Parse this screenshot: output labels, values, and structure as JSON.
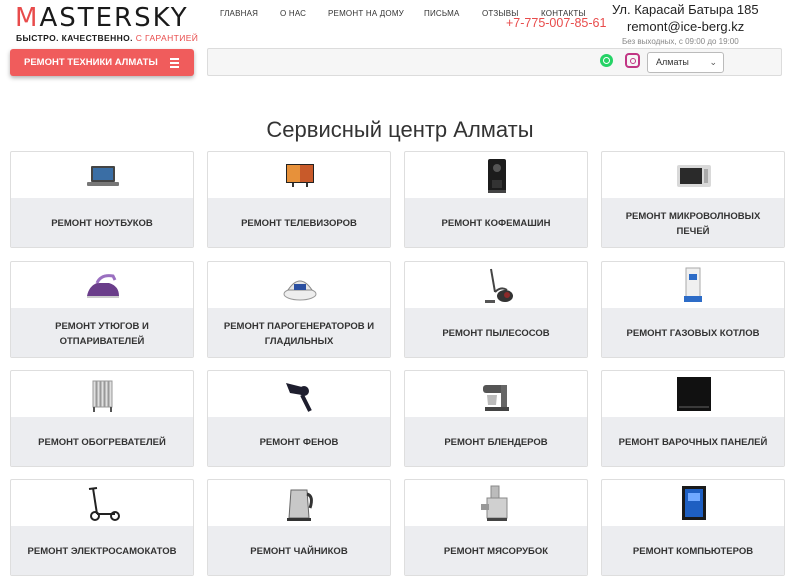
{
  "header": {
    "logo_word": "ASTERSKY",
    "logo_letter": "M",
    "slogan_main": "БЫСТРО. КАЧЕСТВЕННО.",
    "slogan_accent": "С ГАРАНТИЕЙ",
    "phone": "+7-775-007-85-61",
    "address": "Ул. Карасай Батыра 185",
    "email": "remont@ice-berg.kz",
    "hours": "Без выходных, с 09:00 до 19:00"
  },
  "menu_button": {
    "label": "РЕМОНТ ТЕХНИКИ АЛМАТЫ"
  },
  "nav": {
    "items": [
      "ГЛАВНАЯ",
      "О НАС",
      "РЕМОНТ НА ДОМУ",
      "ПИСЬМА",
      "ОТЗЫВЫ",
      "КОНТАКТЫ"
    ],
    "city": "Алматы"
  },
  "icons": {
    "whatsapp": "whatsapp-icon",
    "instagram": "instagram-icon",
    "menu": "hamburger-icon"
  },
  "colors": {
    "accent": "#f05c5c",
    "card_label_bg": "#ecedf0"
  },
  "page_title": "Сервисный центр Алматы",
  "cards": [
    {
      "label": "РЕМОНТ НОУТБУКОВ",
      "icon": "laptop-icon"
    },
    {
      "label": "РЕМОНТ ТЕЛЕВИЗОРОВ",
      "icon": "tv-icon"
    },
    {
      "label": "РЕМОНТ КОФЕМАШИН",
      "icon": "coffee-machine-icon"
    },
    {
      "label": "РЕМОНТ МИКРОВОЛНОВЫХ ПЕЧЕЙ",
      "icon": "microwave-icon"
    },
    {
      "label": "РЕМОНТ УТЮГОВ И ОТПАРИВАТЕЛЕЙ",
      "icon": "iron-icon"
    },
    {
      "label": "РЕМОНТ ПАРОГЕНЕРАТОРОВ И ГЛАДИЛЬНЫХ",
      "icon": "steam-generator-icon"
    },
    {
      "label": "РЕМОНТ ПЫЛЕСОСОВ",
      "icon": "vacuum-icon"
    },
    {
      "label": "РЕМОНТ ГАЗОВЫХ КОТЛОВ",
      "icon": "gas-boiler-icon"
    },
    {
      "label": "РЕМОНТ ОБОГРЕВАТЕЛЕЙ",
      "icon": "heater-icon"
    },
    {
      "label": "РЕМОНТ ФЕНОВ",
      "icon": "hair-dryer-icon"
    },
    {
      "label": "РЕМОНТ БЛЕНДЕРОВ",
      "icon": "blender-icon"
    },
    {
      "label": "РЕМОНТ ВАРОЧНЫХ ПАНЕЛЕЙ",
      "icon": "cooktop-icon"
    },
    {
      "label": "РЕМОНТ ЭЛЕКТРОСАМОКАТОВ",
      "icon": "scooter-icon"
    },
    {
      "label": "РЕМОНТ ЧАЙНИКОВ",
      "icon": "kettle-icon"
    },
    {
      "label": "РЕМОНТ МЯСОРУБОК",
      "icon": "meat-grinder-icon"
    },
    {
      "label": "РЕМОНТ КОМПЬЮТЕРОВ",
      "icon": "computer-icon"
    }
  ]
}
